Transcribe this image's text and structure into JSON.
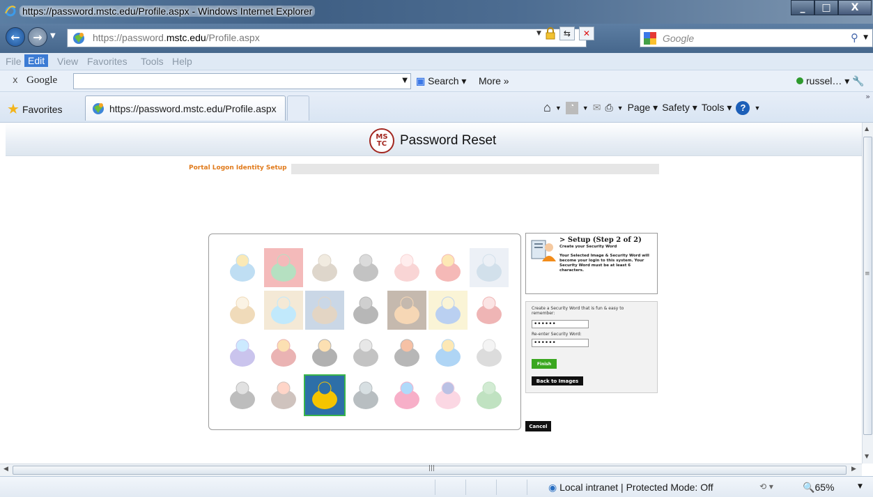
{
  "window": {
    "title": "https://password.mstc.edu/Profile.aspx - Windows Internet Explorer",
    "min": "_",
    "max": "□",
    "close": "X"
  },
  "address": {
    "url_prefix": "https://",
    "url_host": "password.mstc.edu",
    "url_pre_host": "password.",
    "url_domain": "mstc.edu",
    "url_path": "/Profile.aspx",
    "search_placeholder": "Google"
  },
  "menu": [
    "File",
    "Edit",
    "View",
    "Favorites",
    "Tools",
    "Help"
  ],
  "menu_active_index": 1,
  "google_toolbar": {
    "close": "x",
    "logo": "Google",
    "search_label": "Search",
    "more_label": "More »",
    "user": "russel…"
  },
  "tabs": {
    "favorites": "Favorites",
    "active_tab": "https://password.mstc.edu/Profile.aspx"
  },
  "command_bar": {
    "page": "Page",
    "safety": "Safety",
    "tools": "Tools"
  },
  "page": {
    "logo_text": "MS TC",
    "title": "Password Reset",
    "step_tab": "Portal Logon Identity Setup",
    "step_heading": "> Setup (Step 2 of 2)",
    "step_sub": "Create your Security Word",
    "step_desc": "Your Selected Image & Security Word will become your login to this system. Your Security Word must be at least 6 characters.",
    "label_create": "Create a Security Word that is fun & easy to remember:",
    "label_reenter": "Re-enter Security Word:",
    "pw1": "••••••",
    "pw2": "••••••",
    "finish": "Finish",
    "back": "Back to Images",
    "cancel": "Cancel"
  },
  "gallery_images": [
    "figure-on-ball",
    "rainbow-landscape",
    "stacked-stones",
    "motorcycle-jump",
    "cartoon-cat",
    "hibiscus-flower",
    "harbor-boats",
    "teapot-cookies",
    "beach-scene",
    "castle",
    "chess-rook",
    "horse-silhouette",
    "surfer-wave",
    "red-toaster",
    "butterfly",
    "drum",
    "toucan",
    "car-wheel",
    "disco-ball",
    "tropical-fish",
    "kettle",
    "running-shoe",
    "faces-collage",
    "yellow-sports-car",
    "jet-ski",
    "teacups",
    "heart-shapes",
    "dinosaur-toy"
  ],
  "selected_image_index": 23,
  "status": {
    "zone": "Local intranet | Protected Mode: Off",
    "zoom": "65%"
  },
  "colors": {
    "accent_orange": "#e07a1b",
    "finish_green": "#3aa71f",
    "selected_outline": "#39b54a",
    "seal_red": "#a2261f"
  }
}
